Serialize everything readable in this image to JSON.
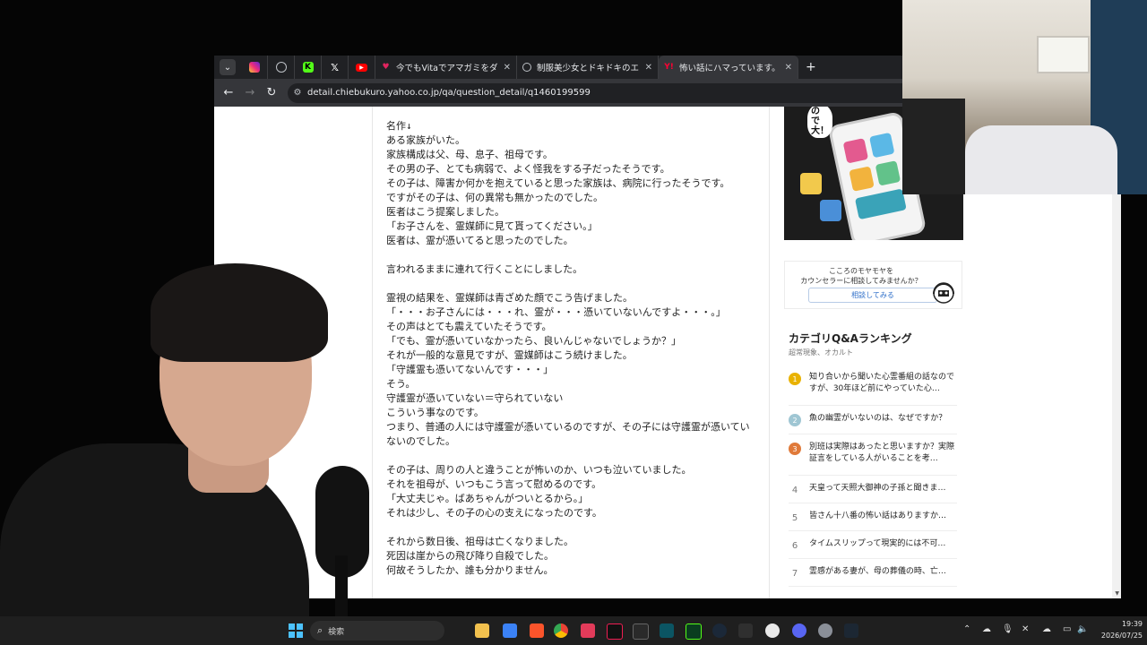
{
  "browser": {
    "tabs": [
      {
        "title": "今でもVitaでアマガミをダウンロード",
        "favicon": "red-heart-icon",
        "active": false
      },
      {
        "title": "制服美少女とドキドキのエロチャット",
        "favicon": "globe-icon",
        "active": false
      },
      {
        "title": "怖い話にハマっています。みなさんが",
        "favicon": "chiebukuro-icon",
        "active": true
      }
    ],
    "address": "detail.chiebukuro.yahoo.co.jp/qa/question_detail/q1460199599",
    "new_tab_glyph": "+"
  },
  "article": {
    "text": "名作↓\nある家族がいた。\n家族構成は父、母、息子、祖母です。\nその男の子、とても病弱で、よく怪我をする子だったそうです。\nその子は、障害か何かを抱えていると思った家族は、病院に行ったそうです。\nですがその子は、何の異常も無かったのでした。\n医者はこう提案しました。\n「お子さんを、霊媒師に見て貰ってください。」\n医者は、霊が憑いてると思ったのでした。\n\n言われるままに連れて行くことにしました。\n\n霊視の結果を、霊媒師は青ざめた顔でこう告げました。\n「・・・お子さんには・・・れ、霊が・・・憑いていないんですよ・・・。」\nその声はとても震えていたそうです。\n「でも、霊が憑いていなかったら、良いんじゃないでしょうか？」\nそれが一般的な意見ですが、霊媒師はこう続けました。\n「守護霊も憑いてないんです・・・」\nそう。\n守護霊が憑いていない＝守られていない\nこういう事なのです。\nつまり、普通の人には守護霊が憑いているのですが、その子には守護霊が憑いていないのでした。\n\nその子は、周りの人と違うことが怖いのか、いつも泣いていました。\nそれを祖母が、いつもこう言って慰めるのです。\n「大丈夫じゃ。ばあちゃんがついとるから。」\nそれは少し、その子の心の支えになったのです。\n\nそれから数日後、祖母は亡くなりました。\n死因は崖からの飛び降り自殺でした。\n何故そうしたか、誰も分かりません。"
  },
  "sidebar": {
    "ad_text": "の\nで\n大！",
    "counsel": {
      "line1": "こころのモヤモヤを",
      "line2": "カウンセラーに相談してみませんか？",
      "button": "相談してみる"
    },
    "ranking": {
      "title": "カテゴリQ&Aランキング",
      "subtitle": "超常現象、オカルト",
      "items": [
        {
          "rank": "1",
          "text": "知り合いから聞いた心霊番組の話なのですが、30年ほど前にやっていた心…",
          "badge_color": "#e9b200"
        },
        {
          "rank": "2",
          "text": "魚の幽霊がいないのは、なぜですか？",
          "badge_color": "#9fc6d3"
        },
        {
          "rank": "3",
          "text": "別班は実際はあったと思いますか？実際証言をしている人がいることを考…",
          "badge_color": "#e07a3a"
        },
        {
          "rank": "4",
          "text": "天皇って天照大御神の子孫と聞きま…",
          "badge_color": ""
        },
        {
          "rank": "5",
          "text": "皆さん十八番の怖い話はありますか…",
          "badge_color": ""
        },
        {
          "rank": "6",
          "text": "タイムスリップって現実的には不可…",
          "badge_color": ""
        },
        {
          "rank": "7",
          "text": "霊感がある妻が、母の葬儀の時、亡…",
          "badge_color": ""
        }
      ]
    }
  },
  "taskbar": {
    "search_placeholder": "検索",
    "time": "19:39",
    "date": "2026/07/25"
  },
  "colors": {
    "tab_strip": "#202124",
    "toolbar": "#35363a",
    "link_blue": "#2f6fc9",
    "taskbar": "#1f1f1f"
  }
}
